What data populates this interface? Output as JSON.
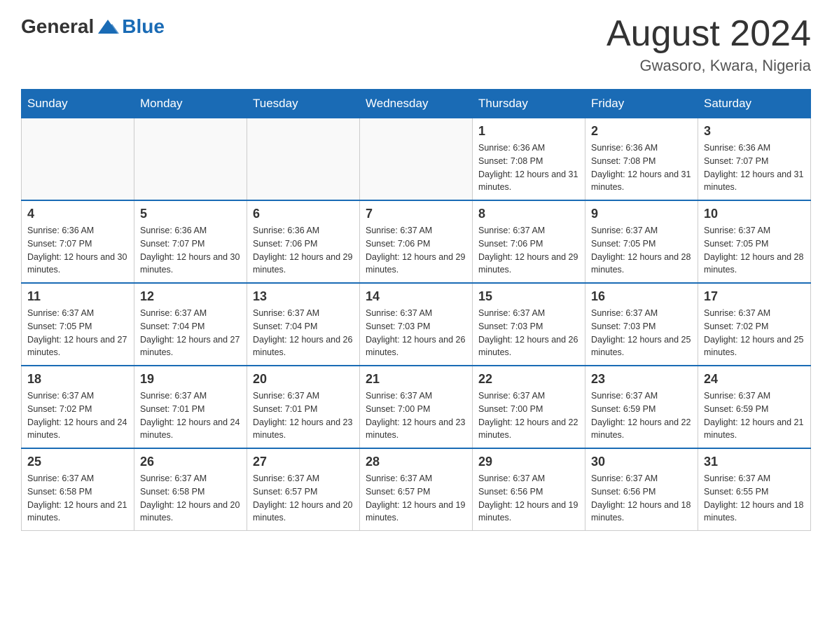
{
  "header": {
    "logo_general": "General",
    "logo_blue": "Blue",
    "month_title": "August 2024",
    "location": "Gwasoro, Kwara, Nigeria"
  },
  "days_of_week": [
    "Sunday",
    "Monday",
    "Tuesday",
    "Wednesday",
    "Thursday",
    "Friday",
    "Saturday"
  ],
  "weeks": [
    {
      "days": [
        {
          "num": "",
          "info": ""
        },
        {
          "num": "",
          "info": ""
        },
        {
          "num": "",
          "info": ""
        },
        {
          "num": "",
          "info": ""
        },
        {
          "num": "1",
          "info": "Sunrise: 6:36 AM\nSunset: 7:08 PM\nDaylight: 12 hours and 31 minutes."
        },
        {
          "num": "2",
          "info": "Sunrise: 6:36 AM\nSunset: 7:08 PM\nDaylight: 12 hours and 31 minutes."
        },
        {
          "num": "3",
          "info": "Sunrise: 6:36 AM\nSunset: 7:07 PM\nDaylight: 12 hours and 31 minutes."
        }
      ]
    },
    {
      "days": [
        {
          "num": "4",
          "info": "Sunrise: 6:36 AM\nSunset: 7:07 PM\nDaylight: 12 hours and 30 minutes."
        },
        {
          "num": "5",
          "info": "Sunrise: 6:36 AM\nSunset: 7:07 PM\nDaylight: 12 hours and 30 minutes."
        },
        {
          "num": "6",
          "info": "Sunrise: 6:36 AM\nSunset: 7:06 PM\nDaylight: 12 hours and 29 minutes."
        },
        {
          "num": "7",
          "info": "Sunrise: 6:37 AM\nSunset: 7:06 PM\nDaylight: 12 hours and 29 minutes."
        },
        {
          "num": "8",
          "info": "Sunrise: 6:37 AM\nSunset: 7:06 PM\nDaylight: 12 hours and 29 minutes."
        },
        {
          "num": "9",
          "info": "Sunrise: 6:37 AM\nSunset: 7:05 PM\nDaylight: 12 hours and 28 minutes."
        },
        {
          "num": "10",
          "info": "Sunrise: 6:37 AM\nSunset: 7:05 PM\nDaylight: 12 hours and 28 minutes."
        }
      ]
    },
    {
      "days": [
        {
          "num": "11",
          "info": "Sunrise: 6:37 AM\nSunset: 7:05 PM\nDaylight: 12 hours and 27 minutes."
        },
        {
          "num": "12",
          "info": "Sunrise: 6:37 AM\nSunset: 7:04 PM\nDaylight: 12 hours and 27 minutes."
        },
        {
          "num": "13",
          "info": "Sunrise: 6:37 AM\nSunset: 7:04 PM\nDaylight: 12 hours and 26 minutes."
        },
        {
          "num": "14",
          "info": "Sunrise: 6:37 AM\nSunset: 7:03 PM\nDaylight: 12 hours and 26 minutes."
        },
        {
          "num": "15",
          "info": "Sunrise: 6:37 AM\nSunset: 7:03 PM\nDaylight: 12 hours and 26 minutes."
        },
        {
          "num": "16",
          "info": "Sunrise: 6:37 AM\nSunset: 7:03 PM\nDaylight: 12 hours and 25 minutes."
        },
        {
          "num": "17",
          "info": "Sunrise: 6:37 AM\nSunset: 7:02 PM\nDaylight: 12 hours and 25 minutes."
        }
      ]
    },
    {
      "days": [
        {
          "num": "18",
          "info": "Sunrise: 6:37 AM\nSunset: 7:02 PM\nDaylight: 12 hours and 24 minutes."
        },
        {
          "num": "19",
          "info": "Sunrise: 6:37 AM\nSunset: 7:01 PM\nDaylight: 12 hours and 24 minutes."
        },
        {
          "num": "20",
          "info": "Sunrise: 6:37 AM\nSunset: 7:01 PM\nDaylight: 12 hours and 23 minutes."
        },
        {
          "num": "21",
          "info": "Sunrise: 6:37 AM\nSunset: 7:00 PM\nDaylight: 12 hours and 23 minutes."
        },
        {
          "num": "22",
          "info": "Sunrise: 6:37 AM\nSunset: 7:00 PM\nDaylight: 12 hours and 22 minutes."
        },
        {
          "num": "23",
          "info": "Sunrise: 6:37 AM\nSunset: 6:59 PM\nDaylight: 12 hours and 22 minutes."
        },
        {
          "num": "24",
          "info": "Sunrise: 6:37 AM\nSunset: 6:59 PM\nDaylight: 12 hours and 21 minutes."
        }
      ]
    },
    {
      "days": [
        {
          "num": "25",
          "info": "Sunrise: 6:37 AM\nSunset: 6:58 PM\nDaylight: 12 hours and 21 minutes."
        },
        {
          "num": "26",
          "info": "Sunrise: 6:37 AM\nSunset: 6:58 PM\nDaylight: 12 hours and 20 minutes."
        },
        {
          "num": "27",
          "info": "Sunrise: 6:37 AM\nSunset: 6:57 PM\nDaylight: 12 hours and 20 minutes."
        },
        {
          "num": "28",
          "info": "Sunrise: 6:37 AM\nSunset: 6:57 PM\nDaylight: 12 hours and 19 minutes."
        },
        {
          "num": "29",
          "info": "Sunrise: 6:37 AM\nSunset: 6:56 PM\nDaylight: 12 hours and 19 minutes."
        },
        {
          "num": "30",
          "info": "Sunrise: 6:37 AM\nSunset: 6:56 PM\nDaylight: 12 hours and 18 minutes."
        },
        {
          "num": "31",
          "info": "Sunrise: 6:37 AM\nSunset: 6:55 PM\nDaylight: 12 hours and 18 minutes."
        }
      ]
    }
  ]
}
